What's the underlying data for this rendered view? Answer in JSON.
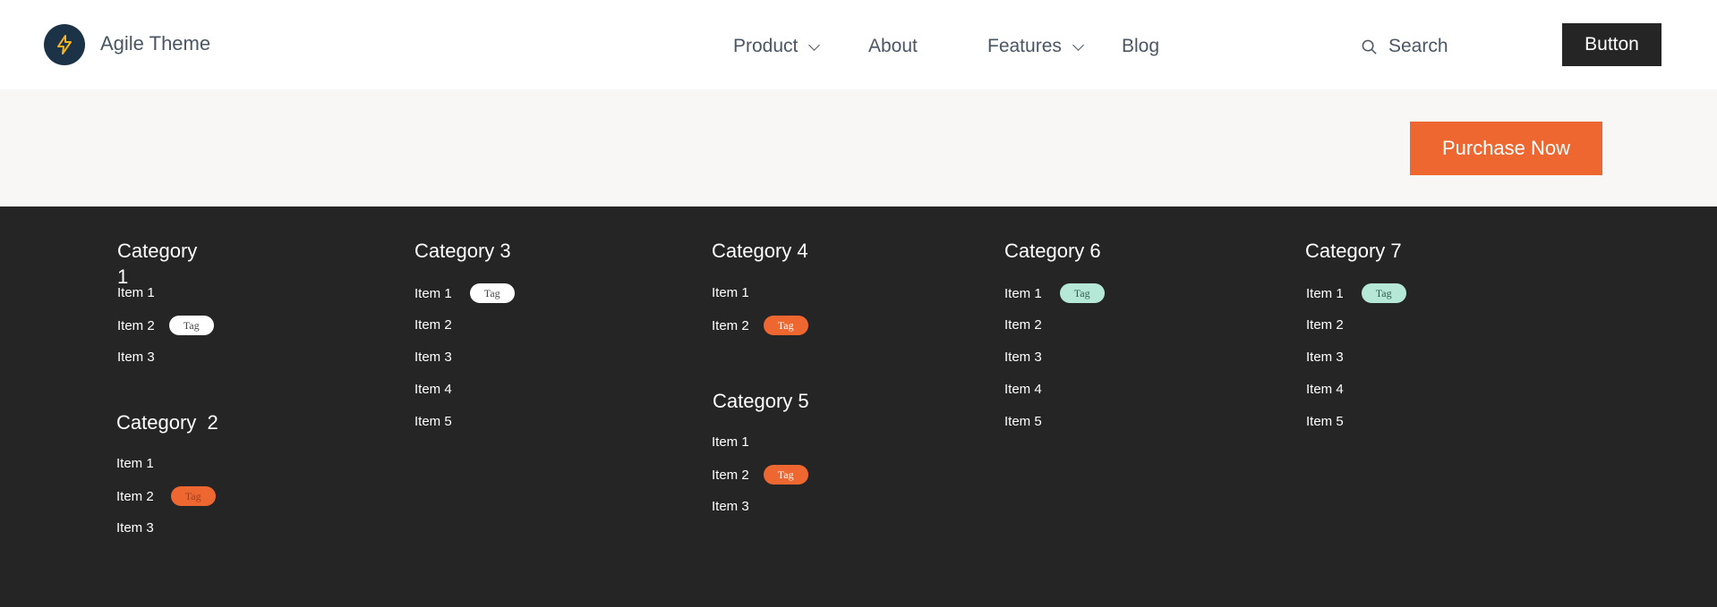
{
  "brand": {
    "name": "Agile Theme",
    "logo_icon": "lightning-bolt-icon",
    "logo_bg": "#1c3347",
    "logo_accent": "#f5b521"
  },
  "nav": [
    {
      "label": "Product",
      "has_dropdown": true
    },
    {
      "label": "About",
      "has_dropdown": false
    },
    {
      "label": "Features",
      "has_dropdown": true
    },
    {
      "label": "Blog",
      "has_dropdown": false
    }
  ],
  "search": {
    "label": "Search",
    "icon": "search-icon"
  },
  "header_button": {
    "label": "Button"
  },
  "cta": {
    "label": "Purchase Now",
    "color": "#ee6731"
  },
  "categories": [
    {
      "title": "Category\n1",
      "items": [
        {
          "label": "Item 1"
        },
        {
          "label": "Item 2",
          "tag": "Tag",
          "tag_style": "white"
        },
        {
          "label": "Item 3"
        }
      ]
    },
    {
      "title": "Category  2",
      "items": [
        {
          "label": "Item 1"
        },
        {
          "label": "Item 2",
          "tag": "Tag",
          "tag_style": "orange"
        },
        {
          "label": "Item 3"
        }
      ]
    },
    {
      "title": "Category 3",
      "items": [
        {
          "label": "Item 1",
          "tag": "Tag",
          "tag_style": "white"
        },
        {
          "label": "Item 2"
        },
        {
          "label": "Item 3"
        },
        {
          "label": "Item 4"
        },
        {
          "label": "Item 5"
        }
      ]
    },
    {
      "title": "Category 4",
      "items": [
        {
          "label": "Item 1"
        },
        {
          "label": "Item 2",
          "tag": "Tag",
          "tag_style": "orange"
        }
      ]
    },
    {
      "title": "Category 5",
      "items": [
        {
          "label": "Item 1"
        },
        {
          "label": "Item 2",
          "tag": "Tag",
          "tag_style": "orange"
        },
        {
          "label": "Item 3"
        }
      ]
    },
    {
      "title": "Category 6",
      "items": [
        {
          "label": "Item 1",
          "tag": "Tag",
          "tag_style": "mint"
        },
        {
          "label": "Item 2"
        },
        {
          "label": "Item 3"
        },
        {
          "label": "Item 4"
        },
        {
          "label": "Item 5"
        }
      ]
    },
    {
      "title": "Category 7",
      "items": [
        {
          "label": "Item 1",
          "tag": "Tag",
          "tag_style": "mint"
        },
        {
          "label": "Item 2"
        },
        {
          "label": "Item 3"
        },
        {
          "label": "Item 4"
        },
        {
          "label": "Item 5"
        }
      ]
    }
  ],
  "colors": {
    "footer_bg": "#252525",
    "band_bg": "#f8f7f5",
    "accent_orange": "#ee6731",
    "tag_mint": "#b5e8d6",
    "nav_text": "#4a5663"
  }
}
